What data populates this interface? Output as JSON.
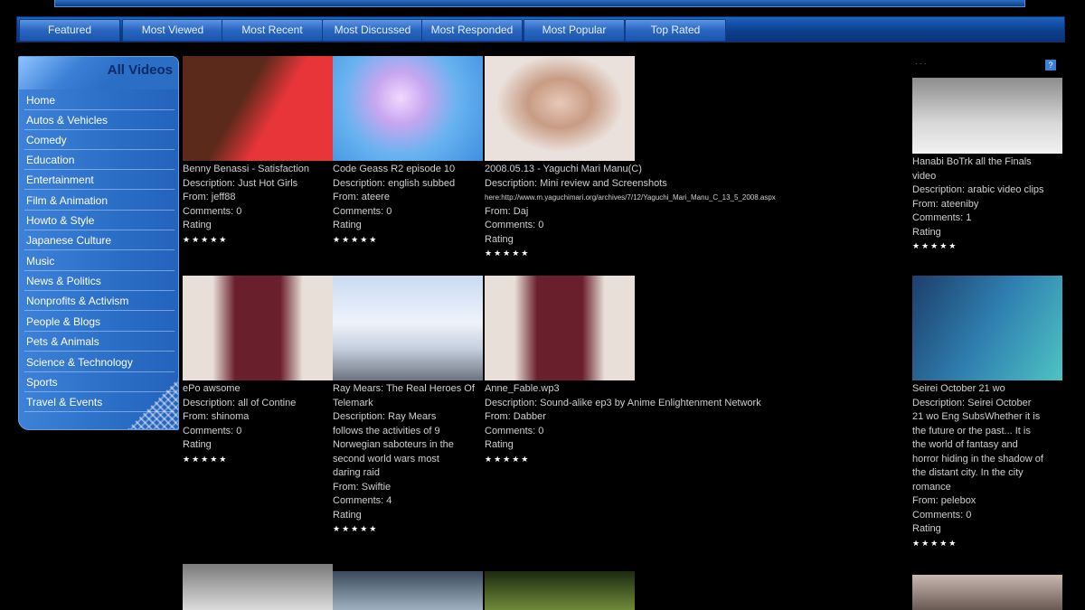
{
  "nav": {
    "tabs": [
      {
        "label": "Featured"
      },
      {
        "label": "Most Viewed"
      },
      {
        "label": "Most Recent"
      },
      {
        "label": "Most Discussed"
      },
      {
        "label": "Most Responded"
      },
      {
        "label": "Most Popular"
      },
      {
        "label": "Top Rated"
      }
    ]
  },
  "sidebar": {
    "title": "All Videos",
    "categories": [
      {
        "label": "Home"
      },
      {
        "label": "Autos & Vehicles"
      },
      {
        "label": "Comedy"
      },
      {
        "label": "Education"
      },
      {
        "label": "Entertainment"
      },
      {
        "label": "Film & Animation"
      },
      {
        "label": "Howto & Style"
      },
      {
        "label": "Japanese Culture"
      },
      {
        "label": "Music"
      },
      {
        "label": "News & Politics"
      },
      {
        "label": "Nonprofits & Activism"
      },
      {
        "label": "People & Blogs"
      },
      {
        "label": "Pets & Animals"
      },
      {
        "label": "Science & Technology"
      },
      {
        "label": "Sports"
      },
      {
        "label": "Travel & Events"
      }
    ]
  },
  "stars": "★★★★★",
  "videos": [
    {
      "title": "Benny Benassi - Satisfaction",
      "description": "Description: Just Hot Girls",
      "from": "From: jeff88",
      "comments": "Comments: 0",
      "rating_label": "Rating",
      "colors": [
        "#e8353a",
        "#7a3b22"
      ]
    },
    {
      "title": "Code Geass R2 episode 10",
      "description": "Description: english subbed",
      "from": "From: ateere",
      "comments": "Comments: 0",
      "rating_label": "Rating",
      "colors": [
        "#7fb8f0",
        "#d9c0f2"
      ]
    },
    {
      "title": "2008.05.13 - Yaguchi Mari Manu(C)",
      "description": "Description: Mini review and Screenshots",
      "extra": "here:http://www.m.yaguchimari.org/archives/7/12/Yaguchi_Mari_Manu_C_13_5_2008.aspx",
      "from": "From: Daj",
      "comments": "Comments: 0",
      "rating_label": "Rating",
      "colors": [
        "#c9a99a",
        "#e6d6cf"
      ]
    },
    {
      "title": "Hanabi BoTrk all the Finals",
      "title2": "video",
      "description": "Description: arabic video clips",
      "from": "From: ateeniby",
      "comments": "Comments: 1",
      "rating_label": "Rating",
      "colors": [
        "#b0b0b0",
        "#ececec"
      ]
    },
    {
      "title": "ePo awsome",
      "description": "Description: all of Contine",
      "from": "From: shinoma",
      "comments": "Comments: 0",
      "rating_label": "Rating",
      "colors": [
        "#d8d0c8",
        "#6a1f2c"
      ]
    },
    {
      "title": "Ray Mears: The Real Heroes Of",
      "description_lines": [
        "Telemark",
        "Description: Ray Mears",
        "follows the activities of 9",
        "Norwegian saboteurs in the",
        "second world wars most",
        "daring raid"
      ],
      "from": "From: Swiftie",
      "comments": "Comments: 4",
      "rating_label": "Rating",
      "colors": [
        "#dbe7f7",
        "#8da7c9"
      ]
    },
    {
      "title": "Anne_Fable.wp3",
      "description": "Description: Sound-alike ep3 by Anime Enlightenment Network",
      "from": "From: Dabber",
      "comments": "Comments: 0",
      "rating_label": "Rating",
      "colors": [
        "#d8d0c8",
        "#6a1f2c"
      ]
    },
    {
      "title": "Seirei October 21 wo",
      "description_lines": [
        "Description: Seirei October",
        "21 wo Eng SubsWhether it is",
        "the future or the past... It is",
        "the world of fantasy and",
        "horror hiding in the shadow of",
        "the distant city. In the city",
        "romance"
      ],
      "from": "From: pelebox",
      "comments": "Comments: 0",
      "rating_label": "Rating",
      "colors": [
        "#1f5a7a",
        "#3fbfbf"
      ]
    }
  ]
}
